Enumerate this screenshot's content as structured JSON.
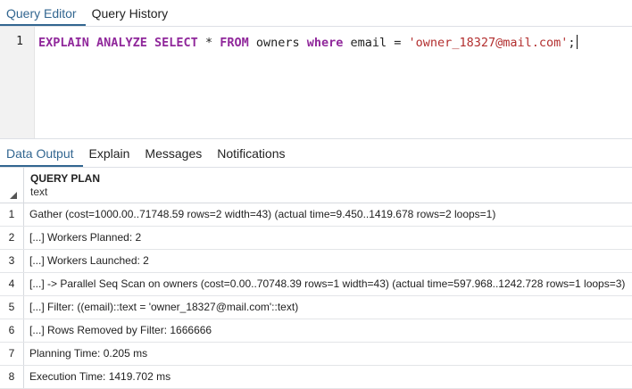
{
  "top_tabs": [
    {
      "label": "Query Editor",
      "active": true
    },
    {
      "label": "Query History",
      "active": false
    }
  ],
  "editor": {
    "line_number": "1",
    "tokens": [
      {
        "text": "EXPLAIN ANALYZE SELECT",
        "kind": "kw"
      },
      {
        "text": " * ",
        "kind": "plain"
      },
      {
        "text": "FROM",
        "kind": "kw"
      },
      {
        "text": " owners ",
        "kind": "plain"
      },
      {
        "text": "where",
        "kind": "kw"
      },
      {
        "text": " email = ",
        "kind": "plain"
      },
      {
        "text": "'owner_18327@mail.com'",
        "kind": "str"
      },
      {
        "text": ";",
        "kind": "plain"
      }
    ]
  },
  "output_tabs": [
    {
      "label": "Data Output",
      "active": true
    },
    {
      "label": "Explain",
      "active": false
    },
    {
      "label": "Messages",
      "active": false
    },
    {
      "label": "Notifications",
      "active": false
    }
  ],
  "grid": {
    "column_name": "QUERY PLAN",
    "column_type": "text",
    "rows": [
      {
        "num": "1",
        "text": "Gather  (cost=1000.00..71748.59 rows=2 width=43) (actual time=9.450..1419.678 rows=2 loops=1)"
      },
      {
        "num": "2",
        "text": "[...] Workers Planned: 2"
      },
      {
        "num": "3",
        "text": "[...] Workers Launched: 2"
      },
      {
        "num": "4",
        "text": "[...] ->  Parallel Seq Scan on owners  (cost=0.00..70748.39 rows=1 width=43) (actual time=597.968..1242.728 rows=1 loops=3)"
      },
      {
        "num": "5",
        "text": "[...] Filter: ((email)::text = 'owner_18327@mail.com'::text)"
      },
      {
        "num": "6",
        "text": "[...] Rows Removed by Filter: 1666666"
      },
      {
        "num": "7",
        "text": "Planning Time: 0.205 ms"
      },
      {
        "num": "8",
        "text": "Execution Time: 1419.702 ms"
      }
    ]
  },
  "colors": {
    "accent": "#326690",
    "keyword": "#90289b",
    "string": "#b22e2e"
  }
}
